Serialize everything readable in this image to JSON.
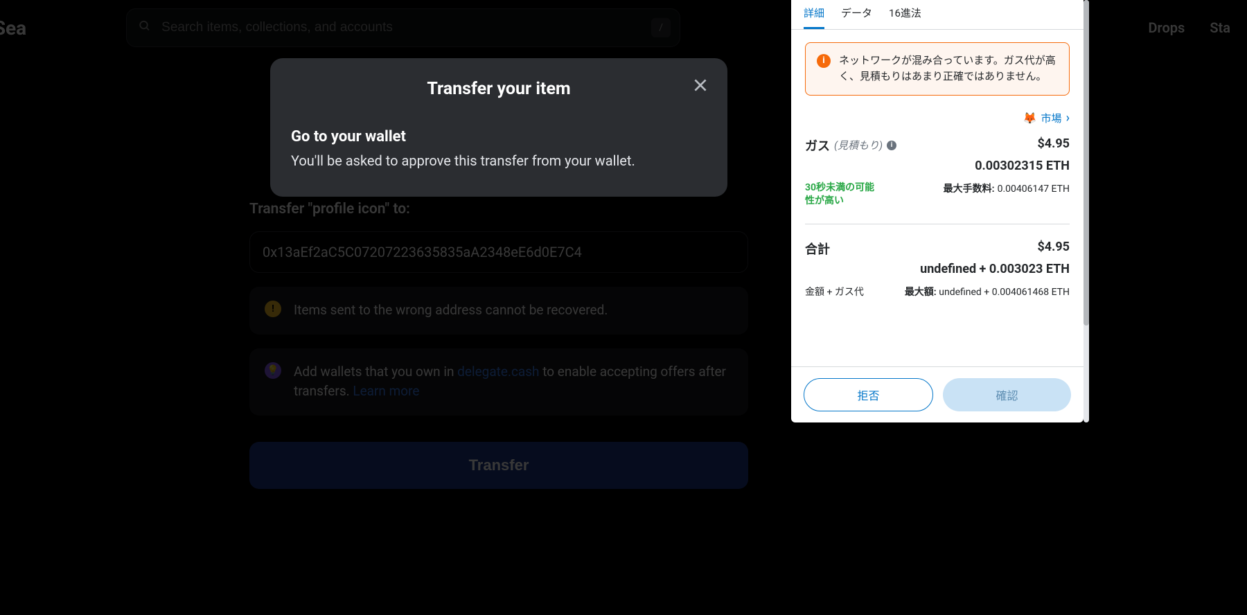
{
  "header": {
    "logo": "enSea",
    "search_placeholder": "Search items, collections, and accounts",
    "search_shortcut": "/",
    "nav": {
      "drops": "Drops",
      "stats": "Sta"
    }
  },
  "transfer": {
    "label": "Transfer \"profile icon\" to:",
    "address": "0x13aEf2aC5C07207223635835aA2348eE6d0E7C4",
    "warning": "Items sent to the wrong address cannot be recovered.",
    "tip_prefix": "Add wallets that you own in ",
    "tip_link1": "delegate.cash",
    "tip_mid": " to enable accepting offers after transfers. ",
    "tip_link2": "Learn more",
    "button": "Transfer"
  },
  "modal": {
    "title": "Transfer your item",
    "heading": "Go to your wallet",
    "text": "You'll be asked to approve this transfer from your wallet."
  },
  "mm": {
    "tabs": {
      "details": "詳細",
      "data": "データ",
      "hex": "16進法"
    },
    "alert": "ネットワークが混み合っています。ガス代が高く、見積もりはあまり正確ではありません。",
    "market": "市場",
    "gas": {
      "label": "ガス",
      "estimate": "(見積もり)",
      "usd": "$4.95",
      "eth": "0.00302315 ETH",
      "green": "30秒未満の可能性が高い",
      "max_label": "最大手数料:",
      "max_value": "0.00406147 ETH"
    },
    "total": {
      "label": "合計",
      "usd": "$4.95",
      "eth": "undefined + 0.003023 ETH",
      "sub_left": "金額 + ガス代",
      "max_label": "最大額:",
      "max_value": "undefined + 0.004061468 ETH"
    },
    "buttons": {
      "reject": "拒否",
      "confirm": "確認"
    }
  }
}
